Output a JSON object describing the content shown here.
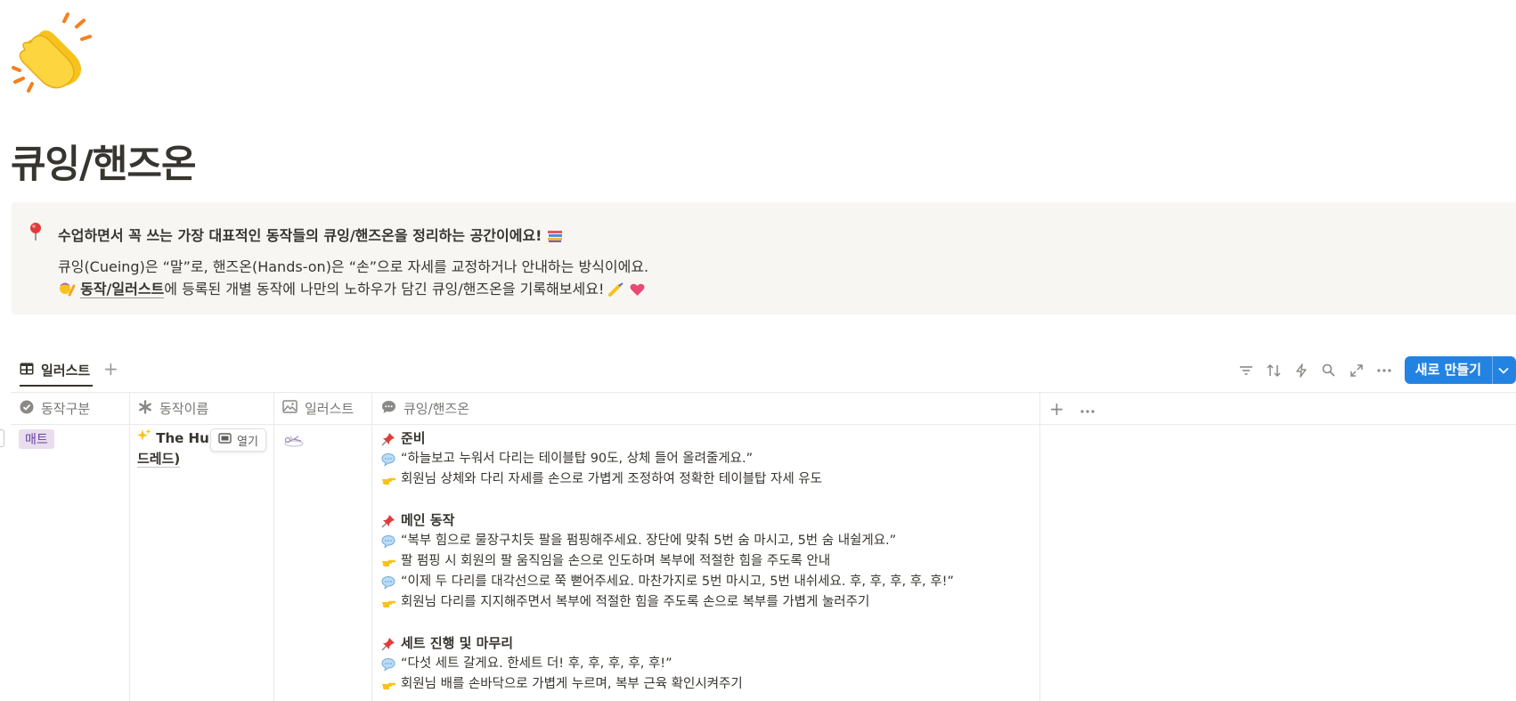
{
  "page": {
    "icon": "clapping-hands-icon",
    "title": "큐잉/핸즈온"
  },
  "callout": {
    "icon": "pin-icon",
    "headline": "수업하면서 꼭 쓰는 가장 대표적인 동작들의 큐잉/핸즈온을 정리하는 공간이에요!",
    "headline_emoji": "books-icon",
    "line1": "큐잉(Cueing)은 “말”로, 핸즈온(Hands-on)은 “손”으로 자세를 교정하거나 안내하는 방식이에요.",
    "line2_emoji": "person-raising-hand-icon",
    "line2_link": "동작/일러스트",
    "line2_text": "에 등록된 개별 동작에 나만의 노하우가 담긴 큐잉/핸즈온을 기록해보세요!",
    "line2_trailing_emojis": [
      "writing-hand-icon",
      "heart-icon"
    ]
  },
  "view": {
    "tab_label": "일러스트",
    "tab_icon": "table-icon",
    "toolbar_icons": [
      "filter-icon",
      "sort-icon",
      "lightning-icon",
      "search-icon",
      "expand-icon",
      "more-icon"
    ],
    "new_button_label": "새로 만들기",
    "accent_color": "#2383e2"
  },
  "table": {
    "headers": {
      "category": "동작구분",
      "name": "동작이름",
      "illustration": "일러스트",
      "cueing": "큐잉/핸즈온"
    },
    "row": {
      "category_tag": "매트",
      "name_line1": "The Hun",
      "name_line2": "드레드)",
      "open_label": "열기",
      "sections": [
        {
          "title": "준비",
          "items": [
            {
              "icon": "speech-bubble-icon",
              "text": "“하늘보고 누워서 다리는 테이블탑 90도, 상체 들어 올려줄게요.”"
            },
            {
              "icon": "pointing-hand-icon",
              "text": "회원님 상체와 다리 자세를 손으로 가볍게 조정하여 정확한 테이블탑 자세 유도"
            }
          ]
        },
        {
          "title": "메인 동작",
          "items": [
            {
              "icon": "speech-bubble-icon",
              "text": "“복부 힘으로 물장구치듯 팔을 펌핑해주세요. 장단에 맞춰 5번 숨 마시고, 5번 숨 내쉴게요.”"
            },
            {
              "icon": "pointing-hand-icon",
              "text": "팔 펌핑 시 회원의 팔 움직임을 손으로 인도하며 복부에 적절한 힘을 주도록 안내"
            },
            {
              "icon": "speech-bubble-icon",
              "text": "“이제 두 다리를 대각선으로 쭉 뻗어주세요. 마찬가지로 5번 마시고, 5번 내쉬세요. 후, 후, 후, 후, 후!”"
            },
            {
              "icon": "pointing-hand-icon",
              "text": "회원님 다리를 지지해주면서 복부에 적절한 힘을 주도록 손으로 복부를 가볍게 눌러주기"
            }
          ]
        },
        {
          "title": "세트 진행 및 마무리",
          "items": [
            {
              "icon": "speech-bubble-icon",
              "text": "“다섯 세트 갈게요. 한세트 더! 후, 후, 후, 후, 후!”"
            },
            {
              "icon": "pointing-hand-icon",
              "text": " 회원님 배를 손바닥으로 가볍게 누르며, 복부 근육 확인시켜주기"
            }
          ]
        }
      ]
    }
  }
}
